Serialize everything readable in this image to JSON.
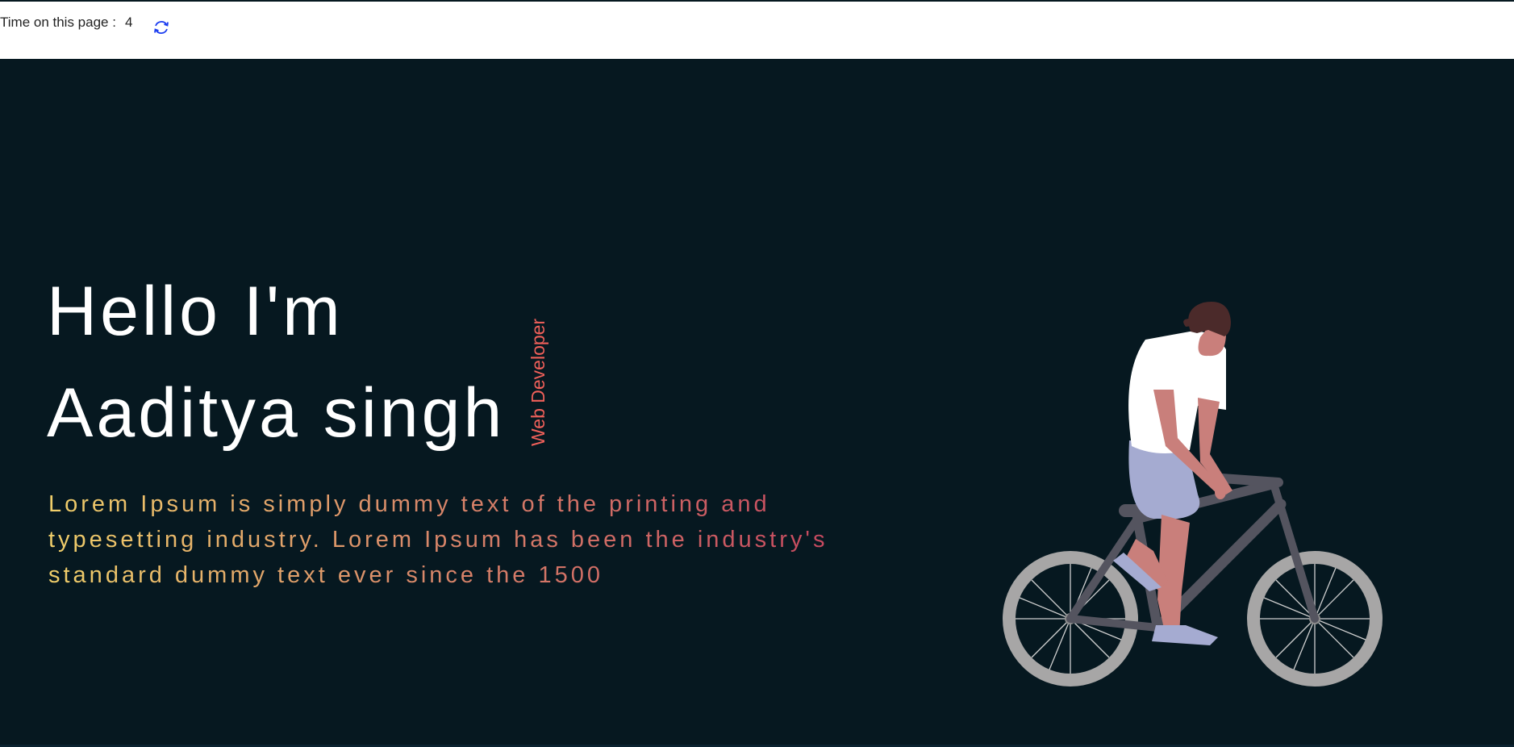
{
  "timer": {
    "label": "Time on this page :",
    "value": "4",
    "refresh_icon": "refresh-icon"
  },
  "hero": {
    "greeting": "Hello  I'm",
    "name": "Aaditya singh",
    "role": "Web Developer",
    "intro": "Lorem Ipsum is simply dummy text of the printing and typesetting industry. Lorem Ipsum has been the industry's standard dummy text ever since the 1500",
    "illustration": "person-riding-bicycle-illustration"
  },
  "colors": {
    "hero_background": "#061820",
    "headline": "#ffffff",
    "role": "#f0605a",
    "intro_gradient_start": "#f0cf6a",
    "intro_gradient_end": "#c4455f",
    "refresh_icon": "#1a3cf0"
  }
}
